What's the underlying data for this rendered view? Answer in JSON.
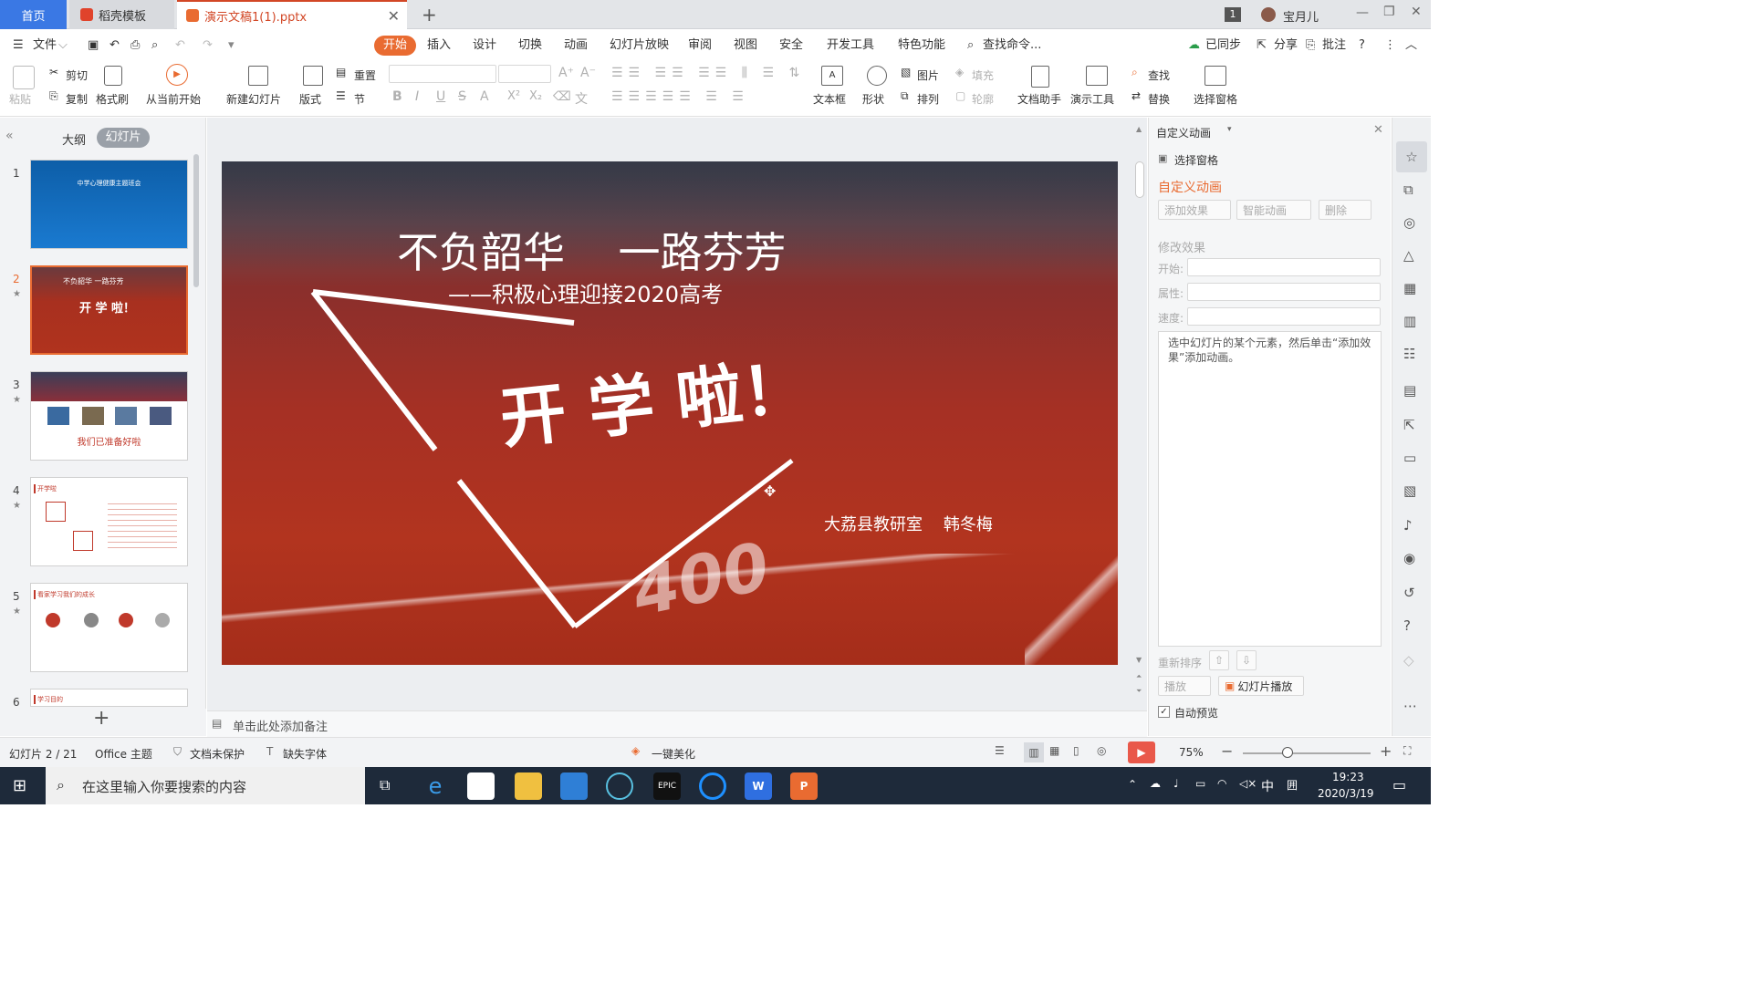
{
  "tabs": {
    "home": "首页",
    "template": "稻壳模板",
    "document": "演示文稿1(1).pptx",
    "window_count": "1",
    "user": "宝月儿"
  },
  "menu": {
    "file": "文件",
    "items": [
      "开始",
      "插入",
      "设计",
      "切换",
      "动画",
      "幻灯片放映",
      "审阅",
      "视图",
      "安全",
      "开发工具",
      "特色功能"
    ],
    "search": "查找命令...",
    "sync": "已同步",
    "share": "分享",
    "comment": "批注"
  },
  "ribbon": {
    "paste": "粘贴",
    "cut": "剪切",
    "copy": "复制",
    "format_painter": "格式刷",
    "from_current": "从当前开始",
    "new_slide": "新建幻灯片",
    "layout": "版式",
    "reset": "重置",
    "section": "节",
    "textbox": "文本框",
    "shape": "形状",
    "picture": "图片",
    "fill": "填充",
    "arrange": "排列",
    "outline": "轮廓",
    "doc_assistant": "文档助手",
    "presentation_tools": "演示工具",
    "find": "查找",
    "replace": "替换",
    "select_pane": "选择窗格"
  },
  "left_panel": {
    "outline_tab": "大纲",
    "slides_tab": "幻灯片",
    "slide_numbers": [
      "1",
      "2",
      "3",
      "4",
      "5",
      "6"
    ],
    "thumb1_title": "中学心理健康主题班会",
    "thumb3_caption": "我们已准备好啦",
    "thumb4_label": "开学啦",
    "thumb5_label": "看家学习我们的成长",
    "thumb6_label": "学习目的"
  },
  "slide": {
    "title": "不负韶华    一路芬芳",
    "subtitle": "——积极心理迎接2020高考",
    "headline": "开 学 啦！",
    "author": "大荔县教研室    韩冬梅",
    "track_number": "400"
  },
  "notes_placeholder": "单击此处添加备注",
  "animation_pane": {
    "header": "自定义动画",
    "select_pane": "选择窗格",
    "title": "自定义动画",
    "add_effect": "添加效果",
    "smart_animation": "智能动画",
    "delete": "删除",
    "modify_effect": "修改效果",
    "start_label": "开始:",
    "property_label": "属性:",
    "speed_label": "速度:",
    "hint": "选中幻灯片的某个元素，然后单击“添加效果”添加动画。",
    "reorder": "重新排序",
    "play": "播放",
    "slideshow": "幻灯片播放",
    "autopreview": "自动预览"
  },
  "status": {
    "slide_pos": "幻灯片 2 / 21",
    "theme": "Office 主题",
    "unprotected": "文档未保护",
    "missing_font": "缺失字体",
    "beautify": "一键美化",
    "zoom": "75%"
  },
  "taskbar": {
    "search_placeholder": "在这里输入你要搜索的内容",
    "ime": "中",
    "time": "19:23",
    "date": "2020/3/19"
  },
  "colors": {
    "accent": "#e96b31",
    "wps_blue": "#3a78e4",
    "track_red": "#b2341f"
  }
}
